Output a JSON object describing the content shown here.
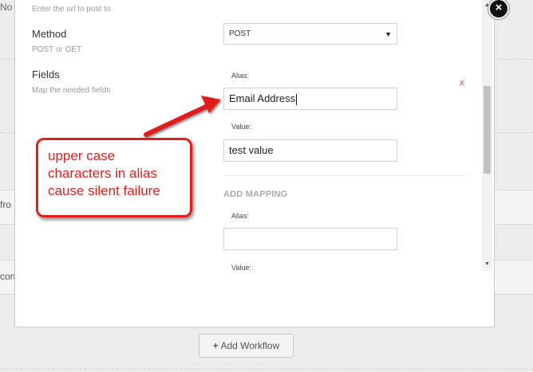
{
  "background": {
    "partial_text_top": "No",
    "partial_text_mid": "fro",
    "partial_text_lower": "con",
    "add_workflow_label": "Add Workflow"
  },
  "modal": {
    "url_help": "Enter the url to post to",
    "method": {
      "label": "Method",
      "help": "POST or GET",
      "selected": "POST"
    },
    "fields": {
      "label": "Fields",
      "help": "Map the needed fields",
      "mappings": [
        {
          "alias_label": "Alias:",
          "alias_value": "Email Address",
          "value_label": "Value:",
          "value_value": "test value",
          "remove": "x"
        }
      ],
      "add_mapping": {
        "heading": "ADD MAPPING",
        "alias_label": "Alias:",
        "alias_value": "",
        "value_label": "Value:"
      }
    }
  },
  "annotation": {
    "lines": [
      "upper case",
      "characters in alias",
      "cause silent failure"
    ],
    "color": "#e01e1e"
  },
  "icons": {
    "close": "close-icon",
    "dropdown": "caret-down-icon",
    "add": "plus-icon"
  }
}
